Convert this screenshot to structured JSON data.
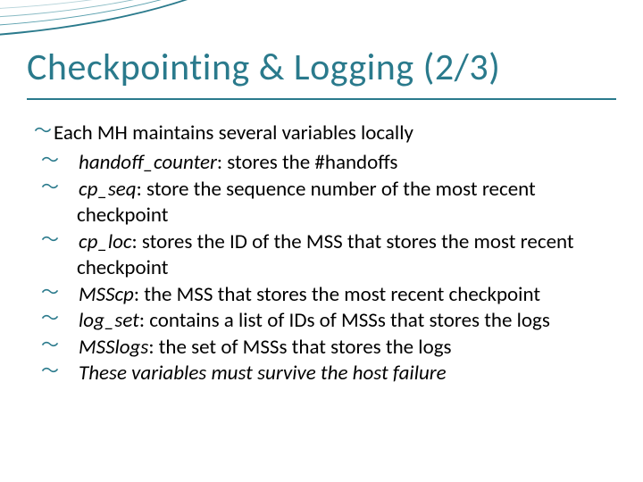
{
  "title": "Checkpointing & Logging (2/3)",
  "main": "Each MH maintains several variables locally",
  "items": [
    {
      "term": "handoff_counter",
      "desc": ": stores the #handoffs"
    },
    {
      "term": "cp_seq",
      "desc": ": store the sequence number of the most recent checkpoint"
    },
    {
      "term": "cp_loc",
      "desc": ": stores the ID of the MSS that stores the most recent checkpoint"
    },
    {
      "term": "MSScp",
      "desc": ": the MSS that stores the most recent checkpoint"
    },
    {
      "term": "log_set",
      "desc": ": contains a list of IDs of MSSs that stores the logs"
    },
    {
      "term": "MSSlogs",
      "desc": ": the set of MSSs that stores the logs"
    },
    {
      "term": "These variables must survive the host failure",
      "desc": ""
    }
  ]
}
